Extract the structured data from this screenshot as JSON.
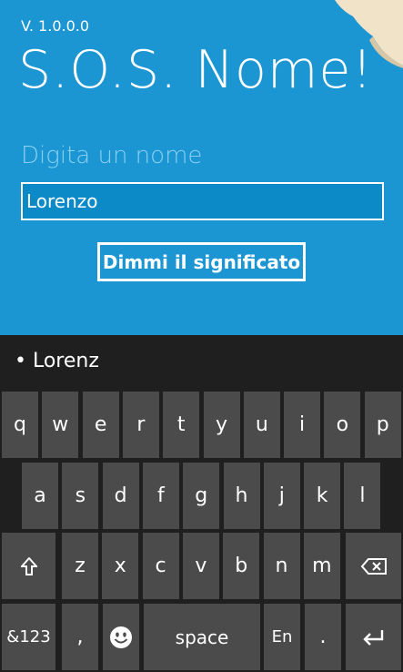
{
  "app": {
    "version": "V. 1.0.0.0",
    "title": "S.O.S. Nome!",
    "prompt": "Digita un nome",
    "input_value": "Lorenzo",
    "button_label": "Dimmi il significato"
  },
  "colors": {
    "app_background": "#1b96d3",
    "input_background": "#0c8ac8",
    "keyboard_background": "#1f1f1f",
    "key_background": "#4b4b4b"
  },
  "keyboard": {
    "suggestion": "•  Lorenz",
    "row1": [
      "q",
      "w",
      "e",
      "r",
      "t",
      "y",
      "u",
      "i",
      "o",
      "p"
    ],
    "row2": [
      "a",
      "s",
      "d",
      "f",
      "g",
      "h",
      "j",
      "k",
      "l"
    ],
    "row3": [
      "z",
      "x",
      "c",
      "v",
      "b",
      "n",
      "m"
    ],
    "numbers_label": "&123",
    "comma_label": ",",
    "space_label": "space",
    "language_label": "En",
    "period_label": ".",
    "icons": {
      "shift": "shift-arrow-icon",
      "backspace": "backspace-icon",
      "emoji": "emoji-smiley-icon",
      "enter": "enter-icon"
    }
  }
}
